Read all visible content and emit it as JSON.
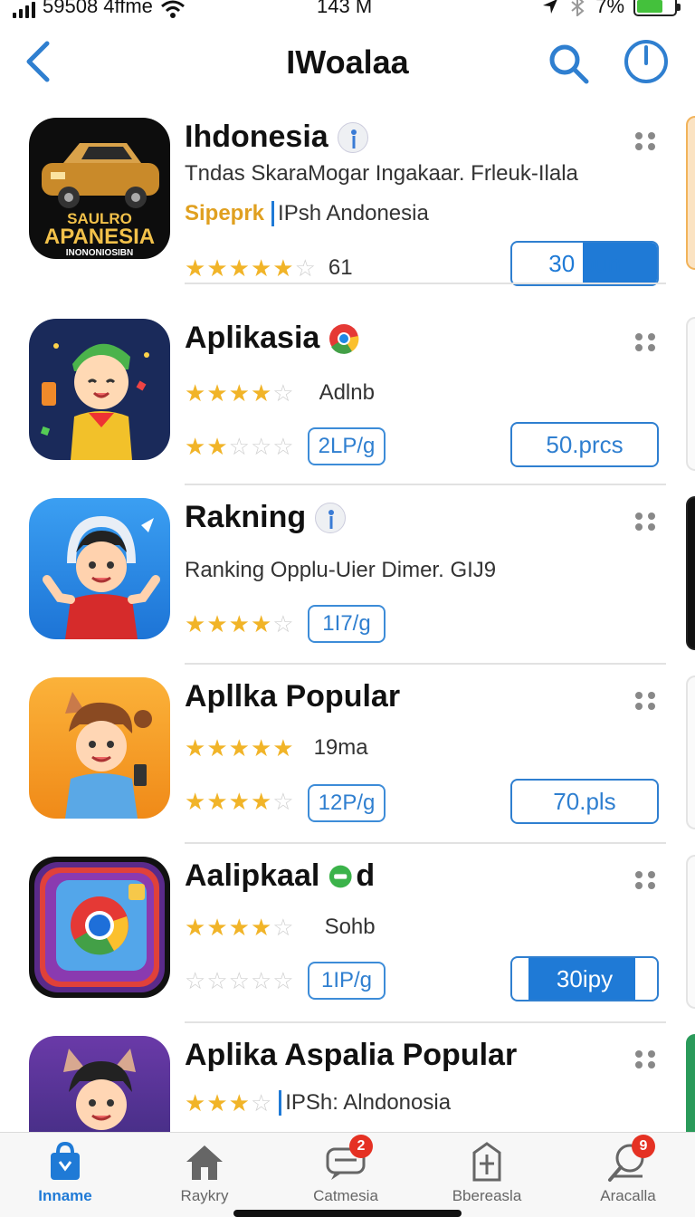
{
  "status_bar": {
    "carrier": "59508 4ffme",
    "time": "143 M",
    "battery": "7%"
  },
  "nav": {
    "title": "IWoalaa"
  },
  "apps": [
    {
      "name": "Ihdonesia",
      "line1": "Tndas SkaraMogar Ingakaar. Frleuk-Ilala",
      "line2_prefix": "Sipeprk",
      "line2_text": "IPsh Andonesia",
      "rating_count": "61",
      "button": "30 bun",
      "icon_title": "SAULRO",
      "icon_subtitle": "APANESIA",
      "icon_caption": "INONONIOSIBN"
    },
    {
      "name": "Aplikasia",
      "line1": "Adlnb",
      "size": "2LP/g",
      "button": "50.prcs"
    },
    {
      "name": "Rakning",
      "line1": "Ranking Opplu-Uier Dimer. GIJ9",
      "size": "1I7/g"
    },
    {
      "name": "Apllka Popular",
      "line1": "19ma",
      "size": "12P/g",
      "button": "70.pls"
    },
    {
      "name": "Aalipkaal",
      "name_suffix": "d",
      "line1": "Sohb",
      "size": "1IP/g",
      "button": "30ipy"
    },
    {
      "name": "Aplika Aspalia Popular",
      "line1": "IPSh: Alndonosia"
    }
  ],
  "tabs": [
    {
      "label": "Inname",
      "icon": "shopping-bag-icon"
    },
    {
      "label": "Raykry",
      "icon": "home-icon"
    },
    {
      "label": "Catmesia",
      "icon": "chat-icon",
      "badge": "2"
    },
    {
      "label": "Bbereasla",
      "icon": "bookmark-icon"
    },
    {
      "label": "Aracalla",
      "icon": "search-icon",
      "badge": "9"
    }
  ],
  "colors": {
    "accent": "#1f7ad6",
    "star": "#f1b428",
    "badge": "#e53123"
  }
}
